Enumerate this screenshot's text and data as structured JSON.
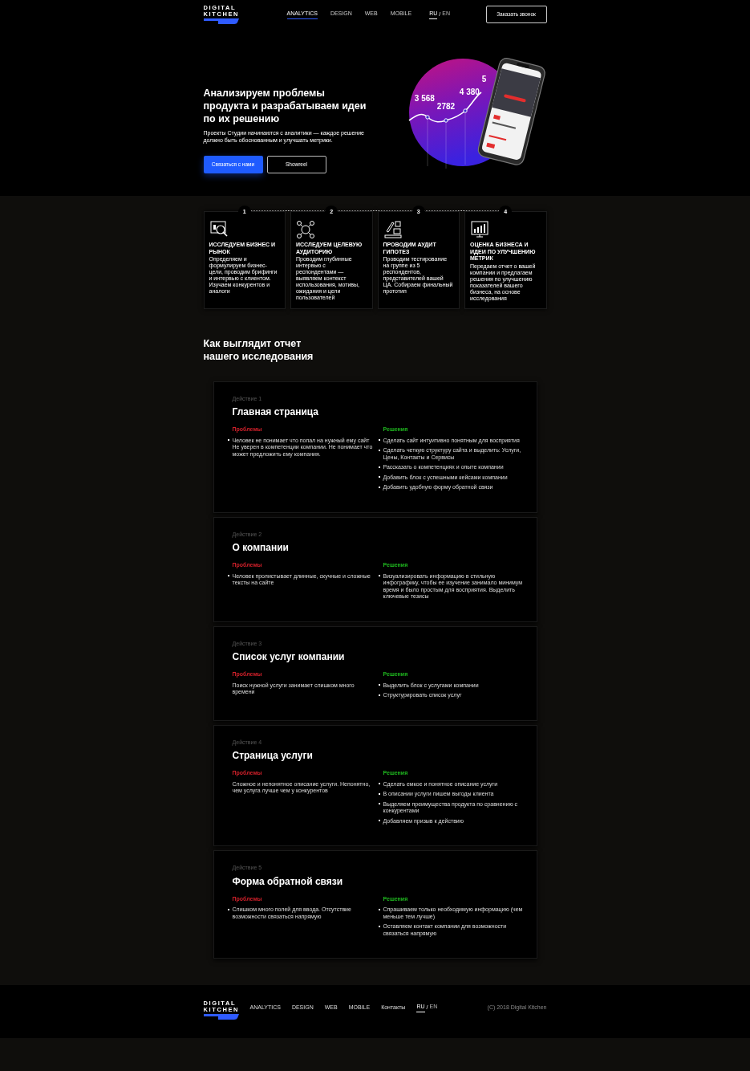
{
  "header": {
    "logo": [
      "DIGITAL",
      "KITCHEN"
    ],
    "nav": [
      {
        "label": "ANALYTICS",
        "selected": true
      },
      {
        "label": "DESIGN",
        "selected": false
      },
      {
        "label": "WEB",
        "selected": false
      },
      {
        "label": "MOBILE",
        "selected": false
      }
    ],
    "languages": [
      {
        "label": "RU",
        "selected": true
      },
      {
        "label": "EN",
        "selected": false
      }
    ],
    "language_separator": "/",
    "cta": "Заказать звонок"
  },
  "hero": {
    "title": "Анализируем проблемы продукта и разрабатываем идеи по их решению",
    "subtitle": "Проекты Студии начинаются с аналитики — каждое решение должно быть обоснованным и улучшать метрики.",
    "buttons": [
      {
        "label": "Связаться с нами",
        "kind": "primary"
      },
      {
        "label": "Showreel",
        "kind": "outline"
      }
    ],
    "chart_labels": [
      "3 568",
      "2782",
      "4 380",
      "5"
    ]
  },
  "steps": [
    {
      "number": "1",
      "title": "ИССЛЕДУЕМ БИЗНЕС И РЫНОК",
      "text": "Определяем и формулируем бизнес-цели, проводим брифинги и интервью с клиентом. Изучаем конкурентов и аналоги"
    },
    {
      "number": "2",
      "title": "ИССЛЕДУЕМ ЦЕЛЕВУЮ АУДИТОРИЮ",
      "text": "Проводим глубинные интервью с респондентами — выявляем контекст использования, мотивы, ожидания и цели пользователей"
    },
    {
      "number": "3",
      "title": "ПРОВОДИМ АУДИТ ГИПОТЕЗ",
      "text": "Проводим тестирование на группе из 5 респондентов, представителей вашей ЦА. Собираем финальный прототип"
    },
    {
      "number": "4",
      "title": "ОЦЕНКА БИЗНЕСА И ИДЕИ ПО УЛУЧШЕНИЮ МЕТРИК",
      "text": "Передаем отчет о вашей компании и предлагаем решения по улучшению показателей вашего бизнеса, на основе исследования"
    }
  ],
  "report": {
    "heading": "Как выглядит отчет нашего исследования",
    "actions": [
      {
        "label": "Действие 1",
        "title": "Главная страница",
        "problems_label": "Проблемы",
        "solutions_label": "Решения",
        "problems": [
          {
            "kind": "bullet",
            "text": "Человек не понимает что попал на нужный ему сайт Не уверен в компетенции компании. Не понимает что может предложить ему компания."
          }
        ],
        "solutions": [
          "Сделать сайт интуитивно понятным для восприятия",
          "Сделать четкую структуру сайта и выделить: Услуги, Цены, Контакты и Сервисы",
          "Рассказать о компетенциях и опыте компании",
          "Добавить блок с успешными кейсами компании",
          "Добавить удобную форму обратной связи"
        ]
      },
      {
        "label": "Действие 2",
        "title": "О компании",
        "problems_label": "Проблемы",
        "solutions_label": "Решения",
        "problems": [
          {
            "kind": "bullet",
            "text": "Человек пролистывает длинные, скучные и сложные тексты на сайте"
          }
        ],
        "solutions": [
          "Визуализировать информацию в стильную инфографику, чтобы ее изучение занимало минимум время и было простым для восприятия. Выделить ключевые тезисы"
        ]
      },
      {
        "label": "Действие 3",
        "title": "Список услуг компании",
        "problems_label": "Проблемы",
        "solutions_label": "Решения",
        "problems": [
          {
            "kind": "plain",
            "text": "Поиск нужной услуги занимает слишком много времени"
          }
        ],
        "solutions": [
          "Выделить блок с услугами компании",
          "Структурировать список услуг"
        ]
      },
      {
        "label": "Действие 4",
        "title": "Страница услуги",
        "problems_label": "Проблемы",
        "solutions_label": "Решения",
        "problems": [
          {
            "kind": "plain",
            "text": "Сложное и непонятное описание услуги. Непонятно, чем услуга лучше чем у конкурентов"
          }
        ],
        "solutions": [
          "Сделать емкое и понятное описание услуги",
          "В описании услуги пишем выгоды клиента",
          "Выделяем преимущества продукта по сравнению с конкурентами",
          "Добавляем призыв к действию"
        ]
      },
      {
        "label": "Действие 5",
        "title": "Форма обратной связи",
        "problems_label": "Проблемы",
        "solutions_label": "Решения",
        "problems": [
          {
            "kind": "bullet",
            "text": "Слишком много полей для ввода. Отсутствие возможности связаться напрямую"
          }
        ],
        "solutions": [
          "Спрашиваем только необходимую информацию (чем меньше тем лучше)",
          "Оставляем контакт компании для возможности связаться напрямую"
        ]
      }
    ]
  },
  "footer": {
    "logo": [
      "DIGITAL",
      "KITCHEN"
    ],
    "nav": [
      {
        "label": "ANALYTICS"
      },
      {
        "label": "DESIGN"
      },
      {
        "label": "WEB"
      },
      {
        "label": "MOBILE"
      },
      {
        "label": "Контакты"
      }
    ],
    "languages": [
      {
        "label": "RU",
        "selected": true
      },
      {
        "label": "EN",
        "selected": false
      }
    ],
    "language_separator": "/",
    "copyright": "(C) 2018 Digital Kitchen"
  }
}
